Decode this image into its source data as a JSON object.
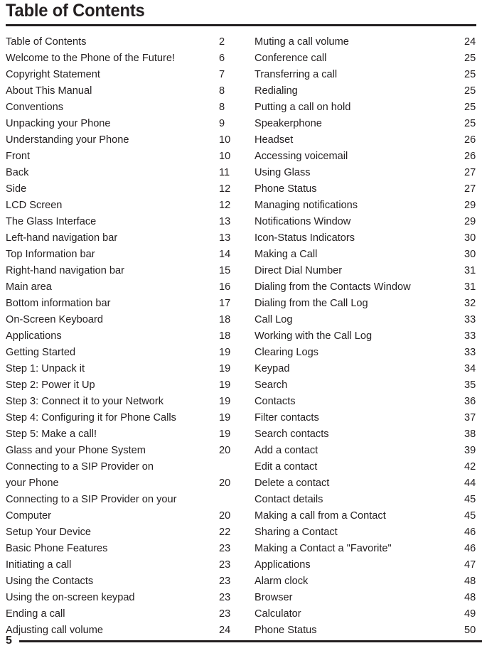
{
  "document": {
    "title": "Table of Contents",
    "folio": "5"
  },
  "toc": {
    "left_column": [
      {
        "label": "Table of Contents",
        "page": "2"
      },
      {
        "label": "Welcome to the Phone of the Future!",
        "page": "6"
      },
      {
        "label": "Copyright Statement",
        "page": "7"
      },
      {
        "label": "About This Manual",
        "page": "8"
      },
      {
        "label": "Conventions",
        "page": "8"
      },
      {
        "label": "Unpacking your Phone",
        "page": "9"
      },
      {
        "label": "Understanding your Phone",
        "page": "10"
      },
      {
        "label": "Front",
        "page": "10"
      },
      {
        "label": "Back",
        "page": "11"
      },
      {
        "label": "Side",
        "page": "12"
      },
      {
        "label": "LCD Screen",
        "page": "12"
      },
      {
        "label": "The Glass Interface",
        "page": "13"
      },
      {
        "label": "Left-hand navigation bar",
        "page": "13"
      },
      {
        "label": "Top Information bar",
        "page": "14"
      },
      {
        "label": "Right-hand navigation bar",
        "page": "15"
      },
      {
        "label": "Main area",
        "page": "16"
      },
      {
        "label": "Bottom information bar",
        "page": "17"
      },
      {
        "label": "On-Screen Keyboard",
        "page": "18"
      },
      {
        "label": "Applications",
        "page": "18"
      },
      {
        "label": "Getting Started",
        "page": "19"
      },
      {
        "label": "Step 1: Unpack it",
        "page": "19"
      },
      {
        "label": "Step 2: Power it Up",
        "page": "19"
      },
      {
        "label": "Step 3: Connect it to your Network",
        "page": "19"
      },
      {
        "label": "Step 4: Configuring it for Phone Calls",
        "page": "19"
      },
      {
        "label": "Step 5: Make a call!",
        "page": "19"
      },
      {
        "label": "Glass and your Phone System",
        "page": "20"
      },
      {
        "label": "Connecting to a SIP Provider on",
        "page": "",
        "continued": true
      },
      {
        "label": "your Phone",
        "page": "20"
      },
      {
        "label": "Connecting to a SIP Provider on your",
        "page": "",
        "continued": true
      },
      {
        "label": "Computer",
        "page": "20"
      },
      {
        "label": "Setup Your Device",
        "page": "22"
      },
      {
        "label": "Basic Phone Features",
        "page": "23"
      },
      {
        "label": "Initiating a call",
        "page": "23"
      },
      {
        "label": "Using the Contacts",
        "page": "23"
      },
      {
        "label": "Using the on-screen keypad",
        "page": "23"
      },
      {
        "label": "Ending a call",
        "page": "23"
      },
      {
        "label": "Adjusting call volume",
        "page": "24"
      }
    ],
    "right_column": [
      {
        "label": "Muting a call volume",
        "page": "24"
      },
      {
        "label": "Conference call",
        "page": "25"
      },
      {
        "label": "Transferring a call",
        "page": "25"
      },
      {
        "label": "Redialing",
        "page": "25"
      },
      {
        "label": "Putting a call on hold",
        "page": "25"
      },
      {
        "label": "Speakerphone",
        "page": "25"
      },
      {
        "label": "Headset",
        "page": "26"
      },
      {
        "label": "Accessing voicemail",
        "page": "26"
      },
      {
        "label": "Using Glass",
        "page": "27"
      },
      {
        "label": "Phone Status",
        "page": "27"
      },
      {
        "label": "Managing notifications",
        "page": "29"
      },
      {
        "label": "Notifications Window",
        "page": "29"
      },
      {
        "label": "Icon-Status Indicators",
        "page": "30"
      },
      {
        "label": "Making a Call",
        "page": "30"
      },
      {
        "label": "Direct Dial Number",
        "page": "31"
      },
      {
        "label": "Dialing from the Contacts Window",
        "page": "31"
      },
      {
        "label": "Dialing from the Call Log",
        "page": "32"
      },
      {
        "label": "Call Log",
        "page": "33"
      },
      {
        "label": "Working with the Call Log",
        "page": "33"
      },
      {
        "label": "Clearing Logs",
        "page": "33"
      },
      {
        "label": "Keypad",
        "page": "34"
      },
      {
        "label": "Search",
        "page": "35"
      },
      {
        "label": "Contacts",
        "page": "36"
      },
      {
        "label": "Filter contacts",
        "page": "37"
      },
      {
        "label": "Search contacts",
        "page": "38"
      },
      {
        "label": "Add a contact",
        "page": "39"
      },
      {
        "label": "Edit a contact",
        "page": "42"
      },
      {
        "label": "Delete a contact",
        "page": "44"
      },
      {
        "label": "Contact details",
        "page": "45"
      },
      {
        "label": "Making a call from a Contact",
        "page": "45"
      },
      {
        "label": "Sharing a Contact",
        "page": "46"
      },
      {
        "label": "Making a Contact a \"Favorite\"",
        "page": "46"
      },
      {
        "label": "Applications",
        "page": "47"
      },
      {
        "label": "Alarm clock",
        "page": "48"
      },
      {
        "label": "Browser",
        "page": "48"
      },
      {
        "label": "Calculator",
        "page": "49"
      },
      {
        "label": "Phone Status",
        "page": "50"
      }
    ]
  }
}
